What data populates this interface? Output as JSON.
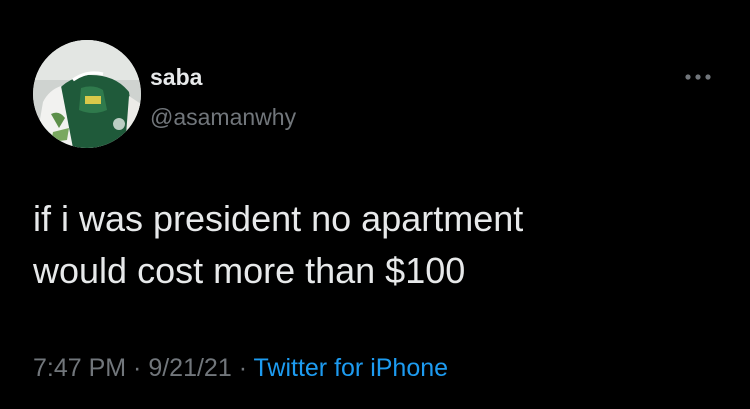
{
  "author": {
    "display_name": "saba",
    "handle": "@asamanwhy",
    "avatar_icon": "profile-photo"
  },
  "more_icon": "ellipsis-icon",
  "tweet": {
    "text": "if i was president no apartment\nwould cost more than $100"
  },
  "meta": {
    "time": "7:47 PM",
    "separator": " · ",
    "date": "9/21/21",
    "source": "Twitter for iPhone"
  },
  "colors": {
    "background": "#000000",
    "primary_text": "#e7e9ea",
    "secondary_text": "#71767b",
    "link": "#1d9bf0"
  }
}
